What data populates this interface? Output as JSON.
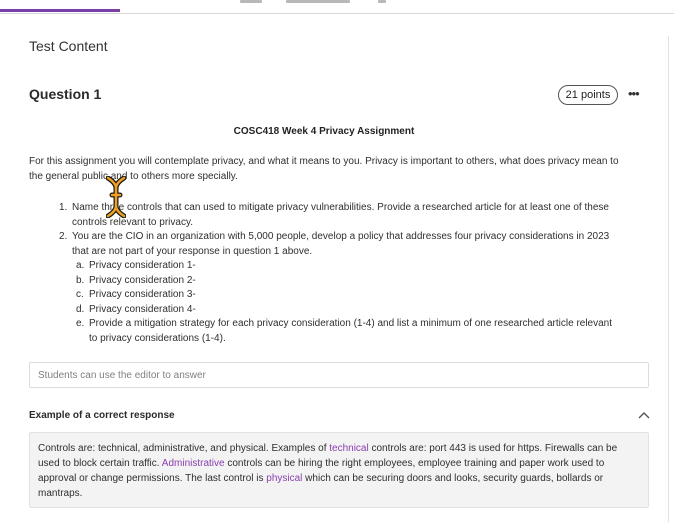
{
  "section_title": "Test Content",
  "question": {
    "title": "Question 1",
    "points": "21 points",
    "menu_icon": "more-horizontal-icon",
    "heading": "COSC418 Week 4 Privacy Assignment",
    "intro": "For this assignment you will contemplate privacy, and what it means to you. Privacy is important to others, what does privacy mean to the general public and to others more specially.",
    "items": [
      {
        "num": "1.",
        "text": "Name three controls that can used to mitigate privacy vulnerabilities. Provide a researched article for at least one of these controls relevant to privacy."
      },
      {
        "num": "2.",
        "text": "You are the CIO in an organization with 5,000 people, develop a policy that addresses four privacy considerations in 2023 that are not part of your response in question 1 above."
      }
    ],
    "subitems": [
      {
        "num": "a.",
        "text": "Privacy consideration 1-"
      },
      {
        "num": "b.",
        "text": "Privacy consideration 2-"
      },
      {
        "num": "c.",
        "text": "Privacy consideration 3-"
      },
      {
        "num": "d.",
        "text": "Privacy consideration 4-"
      },
      {
        "num": "e.",
        "text": "Provide a mitigation strategy for each privacy consideration (1-4) and list a minimum of one researched article relevant to privacy considerations (1-4)."
      }
    ]
  },
  "answer": {
    "placeholder": "Students can use the editor to answer"
  },
  "example": {
    "title": "Example of a correct response",
    "toggle_icon": "chevron-up-icon",
    "p1": "Controls are: technical, administrative, and physical. Examples of ",
    "k1": "technical",
    "p2": " controls are: port 443 is used for https. Firewalls can be used to block certain traffic. ",
    "k2": "Administrative",
    "p3": " controls can be hiring the right employees, employee training and paper work used to approval or change permissions. The last control is ",
    "k3": "physical",
    "p4": " which can be securing doors and looks, security guards, bollards or mantraps."
  },
  "colors": {
    "accent": "#7a3ea8",
    "link": "#8a3fb2",
    "cursor": "#f0a020"
  }
}
